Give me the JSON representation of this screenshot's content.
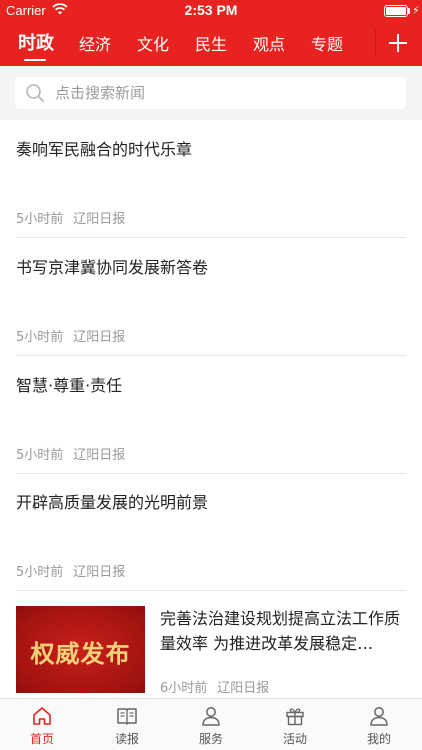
{
  "status_bar": {
    "carrier": "Carrier",
    "time": "2:53 PM",
    "battery_level": 1.0
  },
  "colors": {
    "brand": "#e8231f",
    "meta_text": "#999999",
    "search_bg": "#f4f4f4"
  },
  "tabs": [
    {
      "label": "时政",
      "active": true
    },
    {
      "label": "经济",
      "active": false
    },
    {
      "label": "文化",
      "active": false
    },
    {
      "label": "民生",
      "active": false
    },
    {
      "label": "观点",
      "active": false
    },
    {
      "label": "专题",
      "active": false
    }
  ],
  "add_channel_icon": "plus-icon",
  "search": {
    "placeholder": "点击搜索新闻",
    "value": "",
    "icon": "search-icon"
  },
  "news": [
    {
      "title": "奏响军民融合的时代乐章",
      "time": "5小时前",
      "source": "辽阳日报"
    },
    {
      "title": "书写京津冀协同发展新答卷",
      "time": "5小时前",
      "source": "辽阳日报"
    },
    {
      "title": "智慧·尊重·责任",
      "time": "5小时前",
      "source": "辽阳日报"
    },
    {
      "title": "开辟高质量发展的光明前景",
      "time": "5小时前",
      "source": "辽阳日报"
    }
  ],
  "image_news": {
    "thumb_text": "权威发布",
    "title": "完善法治建设规划提高立法工作质量效率 为推进改革发展稳定…",
    "time": "6小时前",
    "source": "辽阳日报"
  },
  "bottom_nav": [
    {
      "label": "首页",
      "icon": "home-icon",
      "active": true
    },
    {
      "label": "读报",
      "icon": "newspaper-icon",
      "active": false
    },
    {
      "label": "服务",
      "icon": "person-icon",
      "active": false
    },
    {
      "label": "活动",
      "icon": "gift-icon",
      "active": false
    },
    {
      "label": "我的",
      "icon": "user-icon",
      "active": false
    }
  ]
}
